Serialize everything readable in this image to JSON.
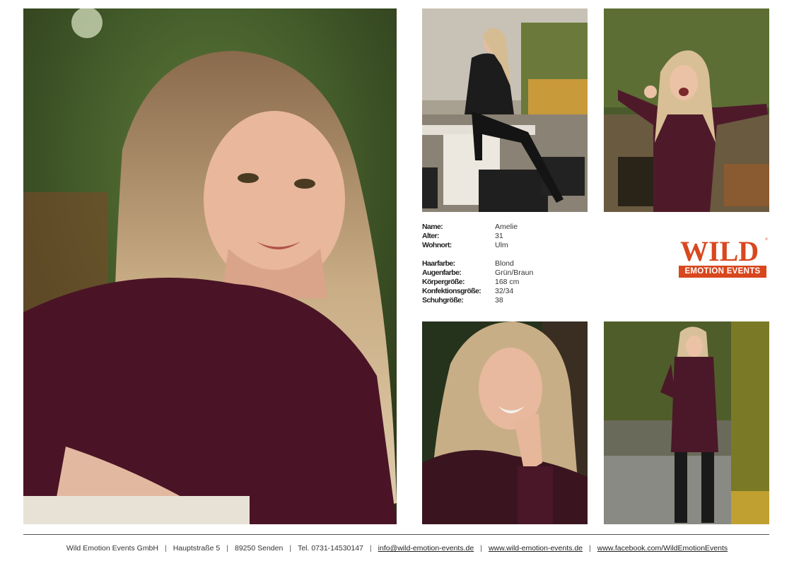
{
  "profile": {
    "rows": [
      {
        "label": "Name:",
        "value": "Amelie"
      },
      {
        "label": "Alter:",
        "value": "31"
      },
      {
        "label": "Wohnort:",
        "value": "Ulm"
      }
    ],
    "rows2": [
      {
        "label": "Haarfarbe:",
        "value": "Blond"
      },
      {
        "label": "Augenfarbe:",
        "value": "Grün/Braun"
      },
      {
        "label": "Körpergröße:",
        "value": "168 cm"
      },
      {
        "label": "Konfektionsgröße:",
        "value": "32/34"
      },
      {
        "label": "Schuhgröße:",
        "value": "38"
      }
    ]
  },
  "logo": {
    "word": "WILD",
    "subtitle": "EMOTION EVENTS",
    "color": "#d8471e"
  },
  "footer": {
    "company": "Wild Emotion Events GmbH",
    "street": "Hauptstraße 5",
    "city": "89250 Senden",
    "phone": "Tel. 0731-14530147",
    "email": "info@wild-emotion-events.de",
    "website": "www.wild-emotion-events.de",
    "facebook": "www.facebook.com/WildEmotionEvents",
    "separator": "|"
  }
}
